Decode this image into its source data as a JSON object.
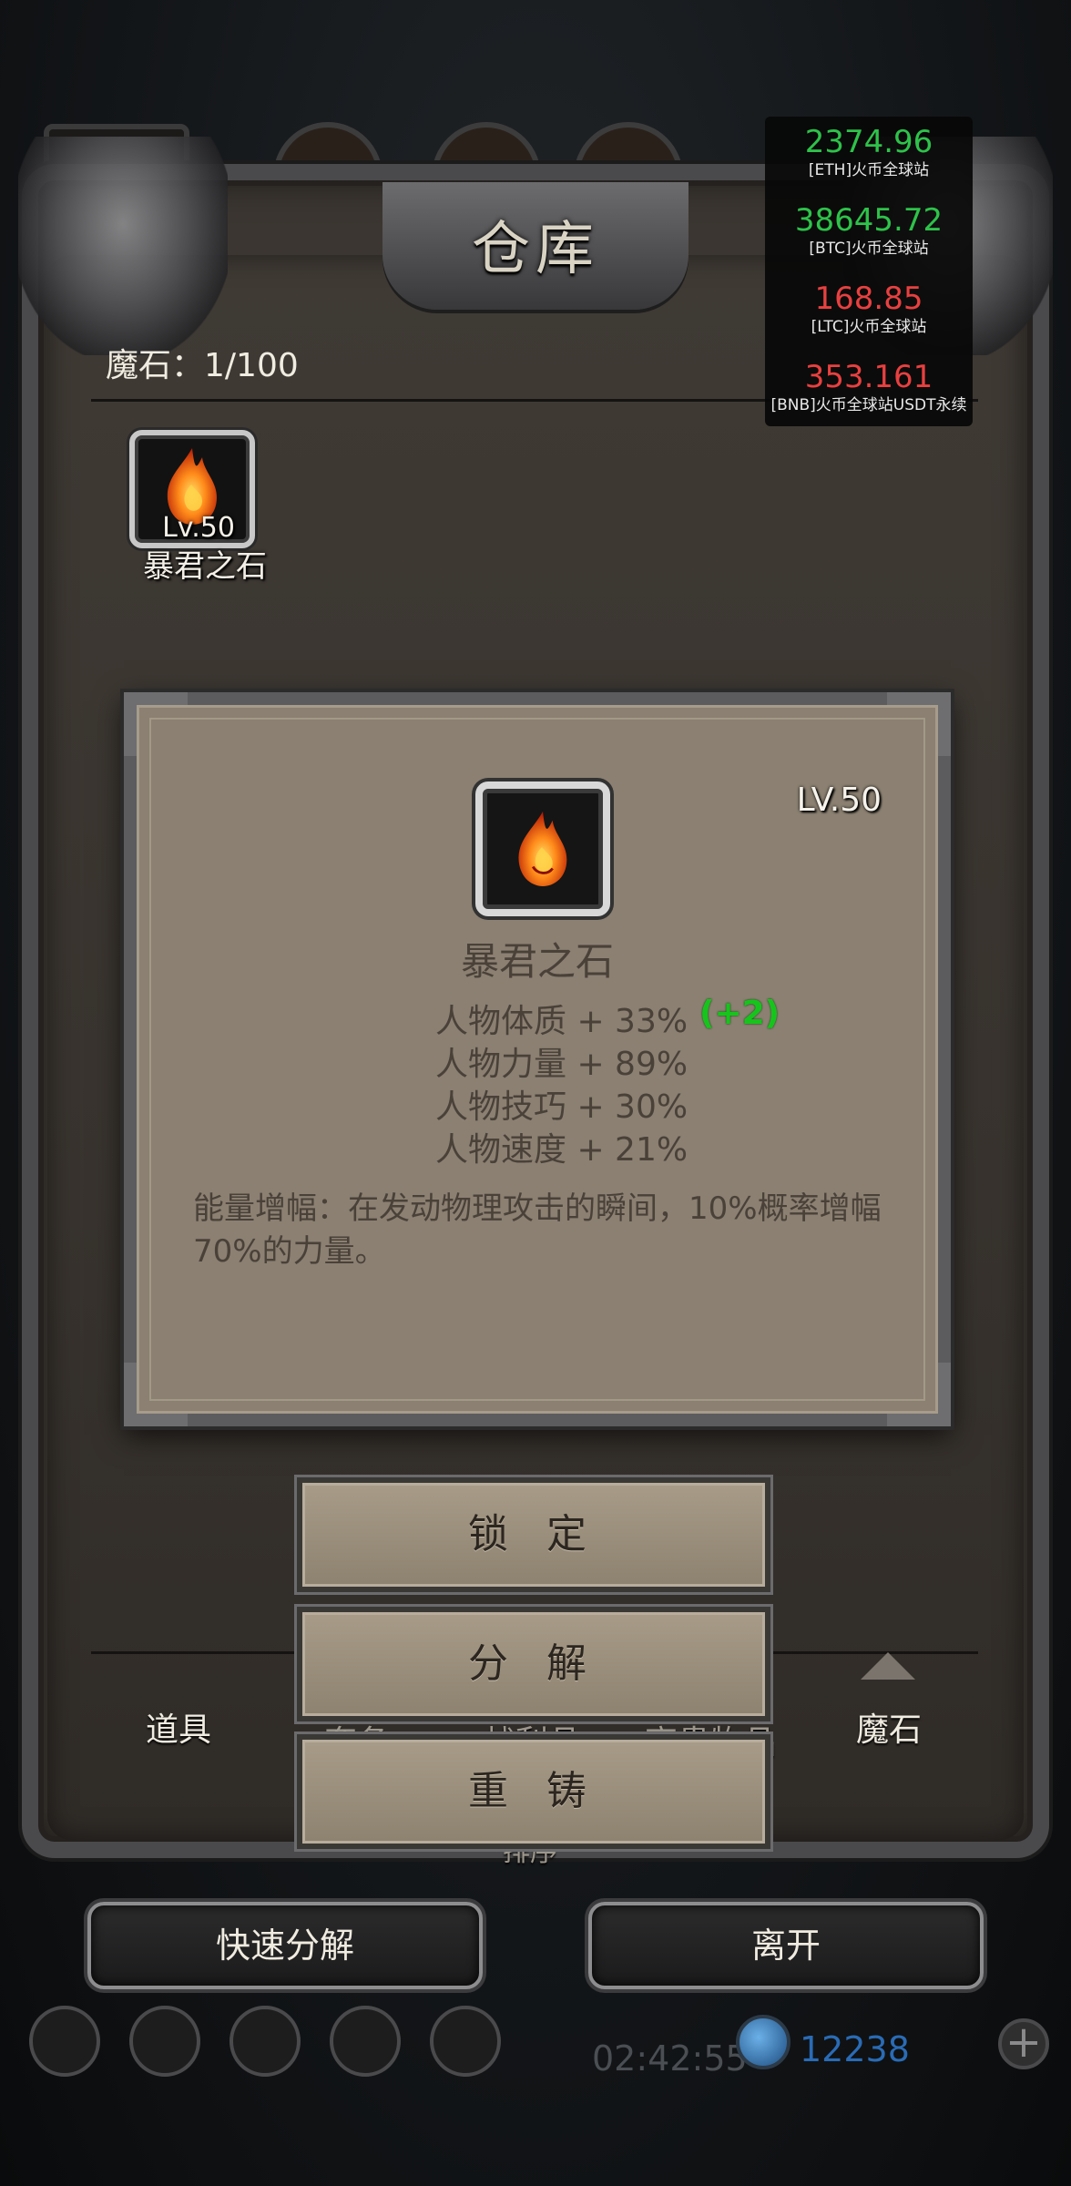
{
  "window": {
    "title": "仓库"
  },
  "header": {
    "magic_stone_count": "魔石：1/100"
  },
  "inventory": {
    "items": [
      {
        "level": "Lv.50",
        "name": "暴君之石",
        "icon": "flame-gem-icon"
      }
    ]
  },
  "detail": {
    "level": "LV.50",
    "name": "暴君之石",
    "icon": "flame-gem-icon",
    "stats": [
      {
        "text": "人物体质 + 33%",
        "bonus": "(+2)"
      },
      {
        "text": "人物力量 + 89%"
      },
      {
        "text": "人物技巧 + 30%"
      },
      {
        "text": "人物速度 + 21%"
      }
    ],
    "effect": "能量增幅：在发动物理攻击的瞬间，10%概率增幅70%的力量。"
  },
  "actions": {
    "lock": "锁 定",
    "decompose": "分 解",
    "recast": "重 铸"
  },
  "tabs": {
    "items": "道具",
    "partial": [
      "套备",
      "战利品",
      "高贵物品"
    ],
    "magic_stone": "魔石",
    "sort_partial": "排序"
  },
  "bottom_buttons": {
    "quick_decompose": "快速分解",
    "leave": "离开"
  },
  "hud": {
    "timer": "02:42:55",
    "gems": "12238",
    "add": "+"
  },
  "ticker": [
    {
      "price": "2374.96",
      "label": "[ETH]火币全球站",
      "trend": "up"
    },
    {
      "price": "38645.72",
      "label": "[BTC]火币全球站",
      "trend": "up"
    },
    {
      "price": "168.85",
      "label": "[LTC]火币全球站",
      "trend": "down"
    },
    {
      "price": "353.161",
      "label": "[BNB]火币全球站USDT永续",
      "trend": "down"
    }
  ],
  "colors": {
    "up": "#2ec24a",
    "down": "#e84040",
    "bonus": "#16c51b",
    "panel": "#8b8071",
    "frame": "#3b3631"
  }
}
